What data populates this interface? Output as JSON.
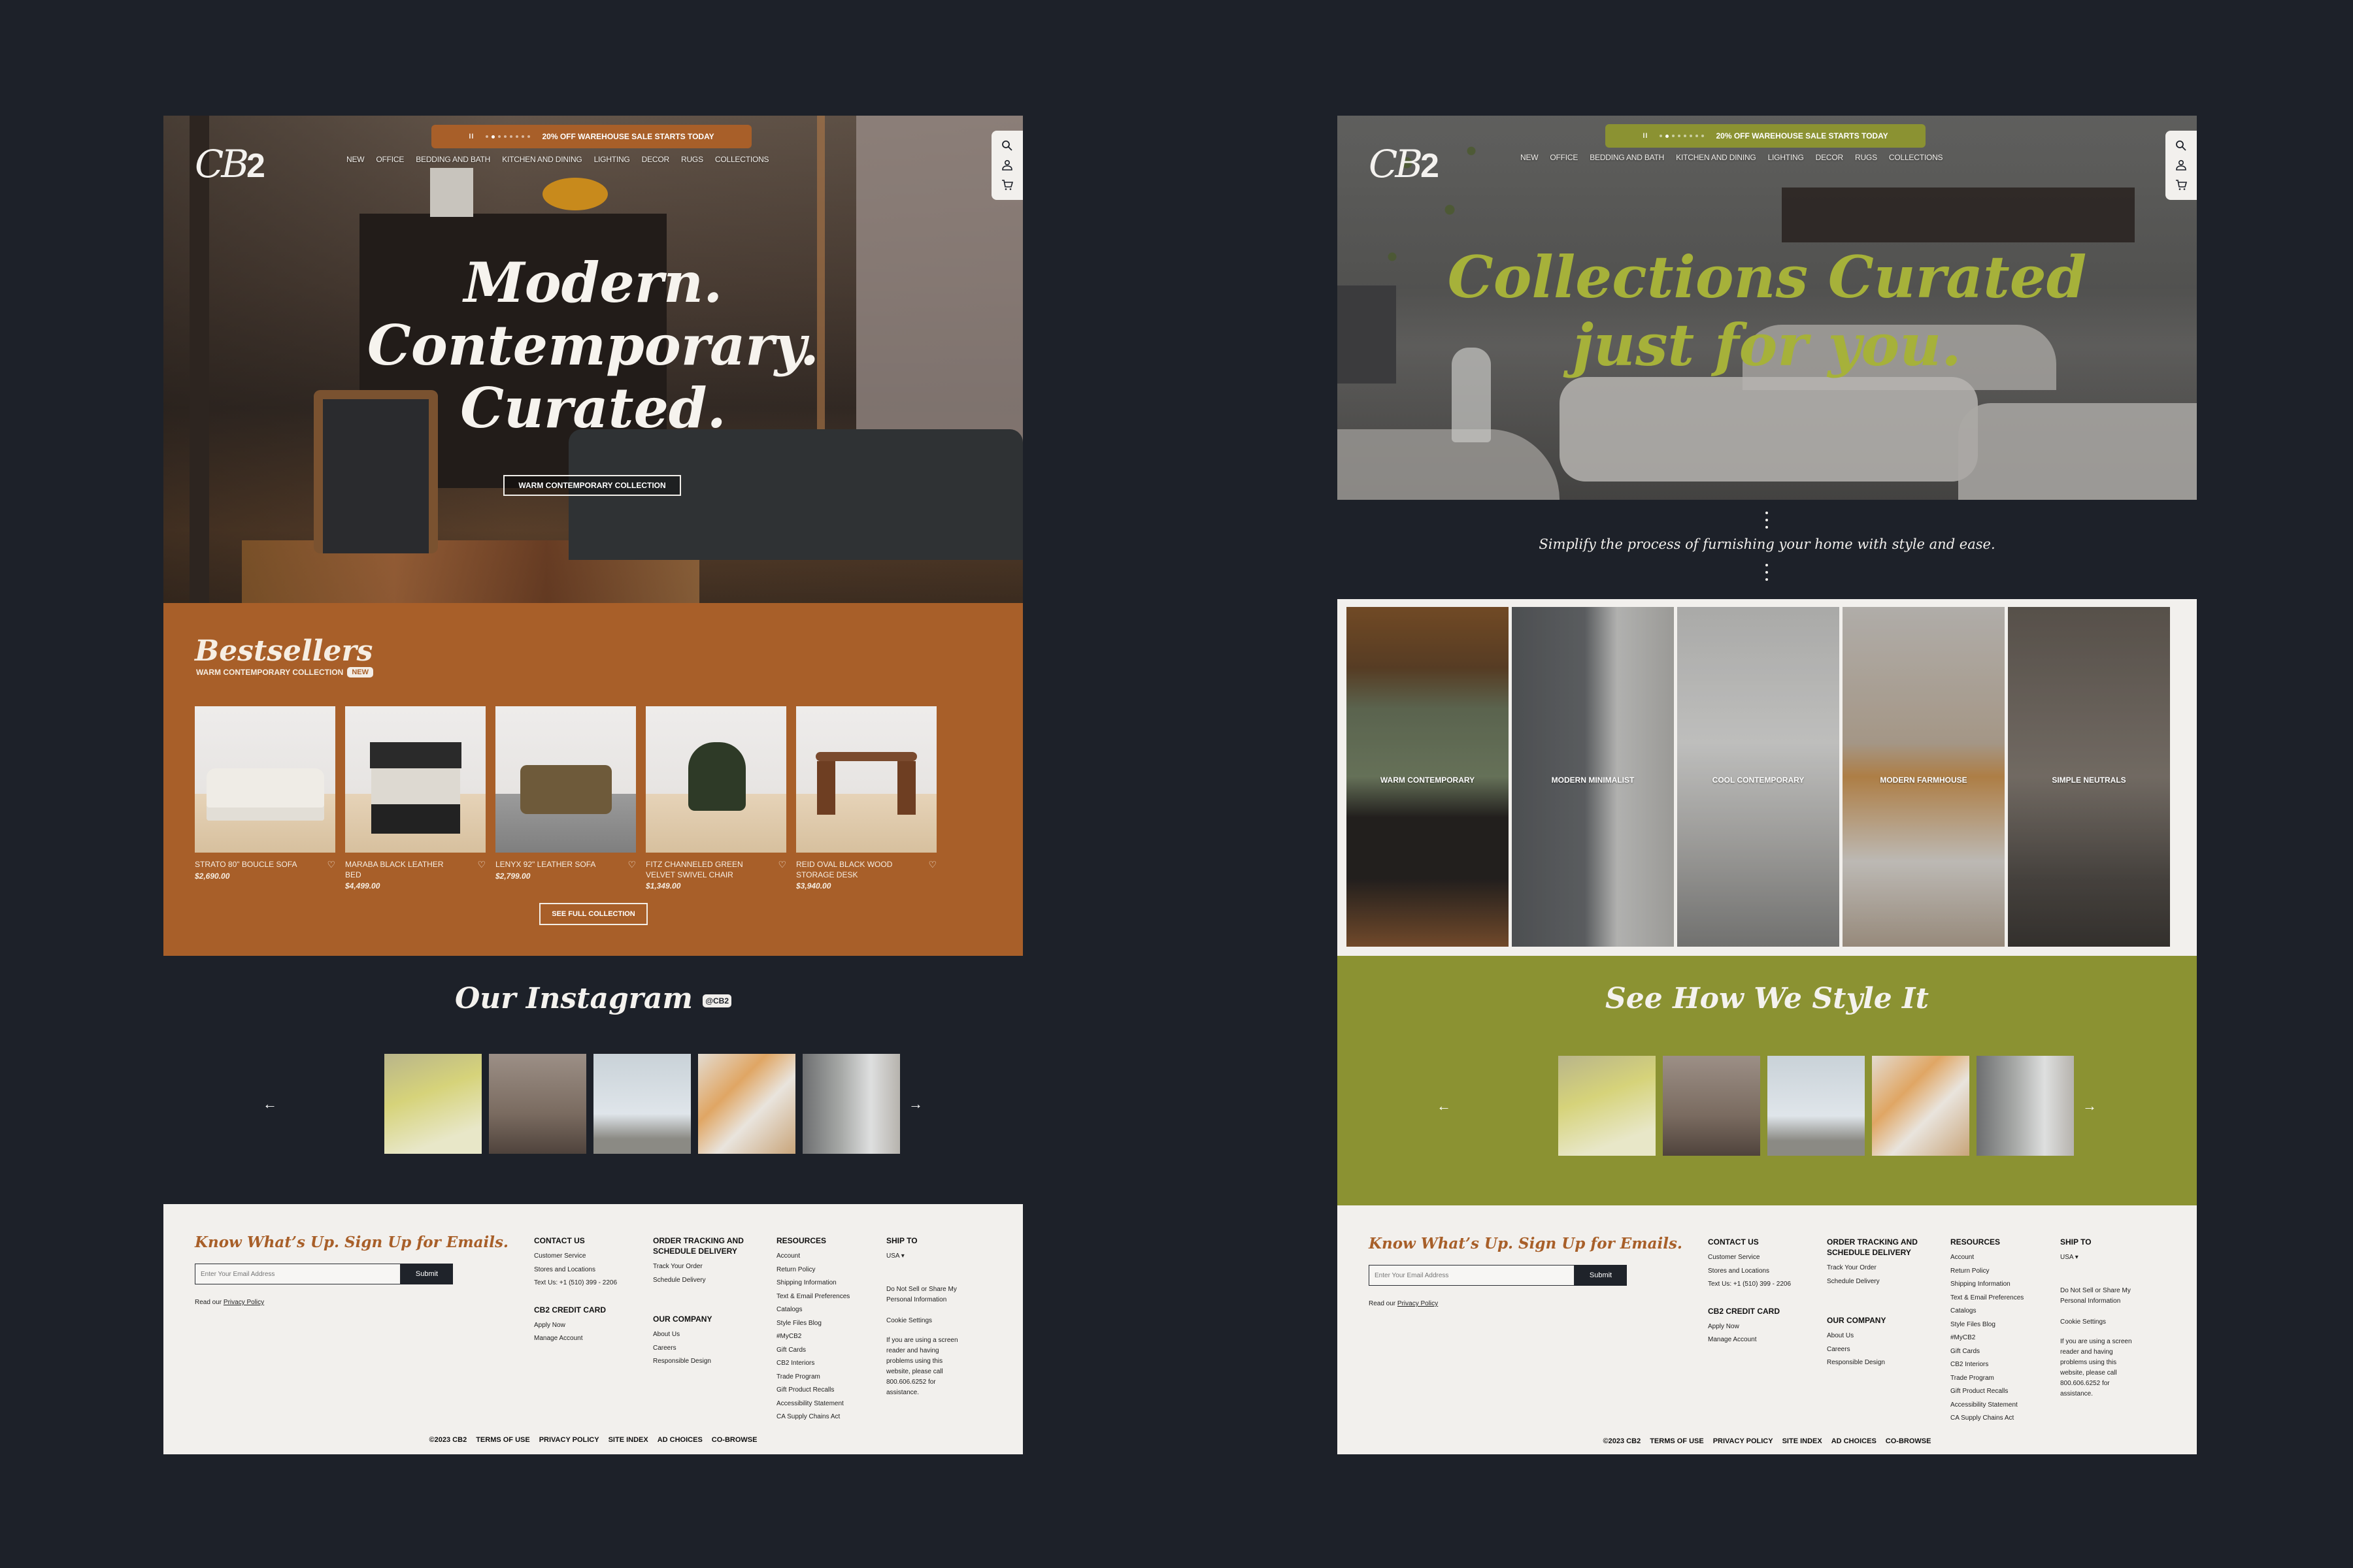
{
  "promo": {
    "pause_glyph": "II",
    "dot_count": 8,
    "active_dot": 2,
    "text": "20% OFF WAREHOUSE SALE STARTS TODAY"
  },
  "brand": {
    "logo_cb": "CB",
    "logo_2": "2"
  },
  "nav": [
    "NEW",
    "OFFICE",
    "BEDDING AND BATH",
    "KITCHEN AND DINING",
    "LIGHTING",
    "DECOR",
    "RUGS",
    "COLLECTIONS"
  ],
  "icons": [
    "search-icon",
    "account-icon",
    "cart-icon"
  ],
  "colors": {
    "rust": "#a85f29",
    "olive": "#8b9232",
    "olive_text": "#a6b13a",
    "dark": "#1d2129",
    "cream": "#f2f0ed"
  },
  "left_page": {
    "hero": {
      "lines": [
        "Modern.",
        "Contemporary.",
        "Curated."
      ],
      "button": "WARM CONTEMPORARY COLLECTION"
    },
    "bestsellers": {
      "title": "Bestsellers",
      "subtitle": "WARM CONTEMPORARY COLLECTION",
      "badge": "NEW",
      "products": [
        {
          "name": "STRATO 80\" BOUCLE SOFA",
          "price": "$2,690.00"
        },
        {
          "name": "MARABA BLACK LEATHER BED",
          "price": "$4,499.00"
        },
        {
          "name": "LENYX 92\" LEATHER SOFA",
          "price": "$2,799.00"
        },
        {
          "name": "FITZ CHANNELED GREEN VELVET SWIVEL CHAIR",
          "price": "$1,349.00"
        },
        {
          "name": "REID OVAL BLACK WOOD STORAGE DESK",
          "price": "$3,940.00"
        }
      ],
      "cta": "SEE FULL COLLECTION"
    },
    "instagram": {
      "title": "Our Instagram",
      "handle": "@CB2",
      "prev": "←",
      "next": "→"
    }
  },
  "right_page": {
    "hero": {
      "line1": "Collections Curated",
      "line2": "just for you."
    },
    "tagline": "Simplify the process of furnishing your home with style and ease.",
    "collections": [
      "WARM CONTEMPORARY",
      "MODERN MINIMALIST",
      "COOL CONTEMPORARY",
      "MODERN FARMHOUSE",
      "SIMPLE NEUTRALS"
    ],
    "style_it": {
      "title": "See How We Style It",
      "prev": "←",
      "next": "→"
    }
  },
  "footer": {
    "signup_heading": "Know What’s Up. Sign Up for Emails.",
    "email_placeholder": "Enter Your Email Address",
    "submit": "Submit",
    "privacy_prefix": "Read our ",
    "privacy_link": "Privacy Policy",
    "contact": {
      "heading": "CONTACT US",
      "links": [
        "Customer Service",
        "Stores and Locations",
        "Text Us: +1 (510) 399 - 2206"
      ]
    },
    "credit": {
      "heading": "CB2 CREDIT CARD",
      "links": [
        "Apply Now",
        "Manage Account"
      ]
    },
    "order": {
      "heading": "ORDER TRACKING AND SCHEDULE DELIVERY",
      "links": [
        "Track Your Order",
        "Schedule Delivery"
      ]
    },
    "company": {
      "heading": "OUR COMPANY",
      "links": [
        "About Us",
        "Careers",
        "Responsible Design"
      ]
    },
    "resources": {
      "heading": "RESOURCES",
      "links": [
        "Account",
        "Return Policy",
        "Shipping Information",
        "Text & Email Preferences",
        "Catalogs",
        "Style Files Blog",
        "#MyCB2",
        "Gift Cards",
        "CB2 Interiors",
        "Trade Program",
        "Gift Product Recalls",
        "Accessibility Statement",
        "CA Supply Chains Act"
      ]
    },
    "ship": {
      "heading": "SHIP TO",
      "country": "USA ▾",
      "do_not_sell": "Do Not Sell or Share My Personal Information",
      "cookie": "Cookie Settings",
      "accessibility_note": "If you are using a screen reader and having problems using this website, please call 800.606.6252 for assistance."
    },
    "bottom": [
      "©2023 CB2",
      "TERMS OF USE",
      "PRIVACY POLICY",
      "SITE INDEX",
      "AD CHOICES",
      "CO-BROWSE"
    ]
  }
}
